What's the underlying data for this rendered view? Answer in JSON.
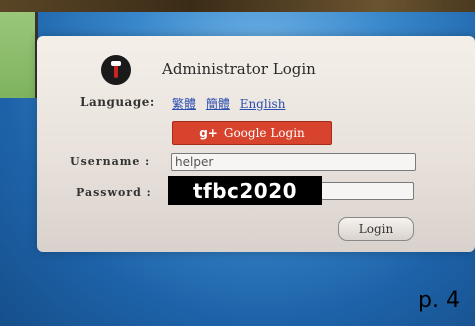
{
  "dialog": {
    "title": "Administrator Login",
    "language_label": "Language:",
    "languages": [
      "繁體",
      "簡體",
      "English"
    ],
    "google_login_label": "Google Login",
    "google_icon_glyph": "g+",
    "username_label": "Username :",
    "username_value": "helper",
    "password_label": "Password :",
    "password_overlay": "tfbc2020",
    "login_label": "Login"
  },
  "page_number": "p. 4",
  "colors": {
    "google_red": "#d8432e",
    "link_blue": "#2a4fb0",
    "background_blue": "#1e63a3"
  }
}
